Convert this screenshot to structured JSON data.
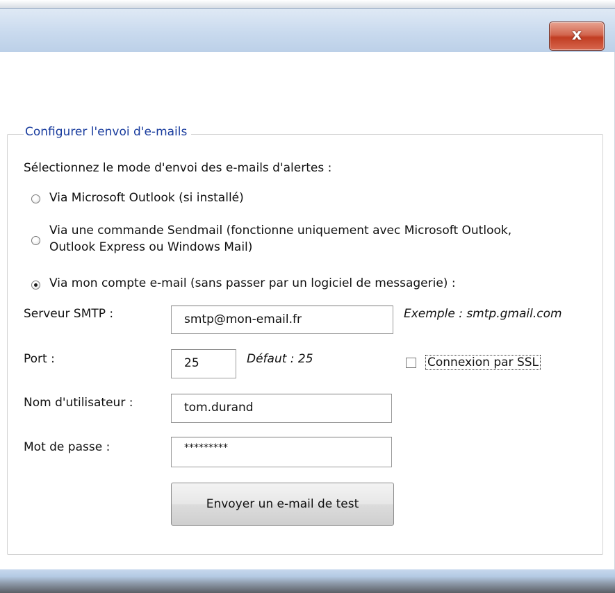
{
  "window": {
    "close_label": "x"
  },
  "group": {
    "title": "Configurer l'envoi d'e-mails",
    "instruction": "Sélectionnez le mode d'envoi des e-mails d'alertes :"
  },
  "modes": {
    "outlook": "Via Microsoft Outlook (si installé)",
    "sendmail_line1": "Via une commande Sendmail (fonctionne uniquement avec Microsoft Outlook,",
    "sendmail_line2": "Outlook Express ou Windows Mail)",
    "account": "Via mon compte e-mail (sans passer par un logiciel de messagerie) :",
    "selected": "account"
  },
  "form": {
    "smtp_label": "Serveur SMTP :",
    "smtp_value": "smtp@mon-email.fr",
    "smtp_hint": "Exemple : smtp.gmail.com",
    "port_label": "Port :",
    "port_value": "25",
    "port_hint": "Défaut : 25",
    "ssl_label": "Connexion par SSL",
    "ssl_checked": false,
    "user_label": "Nom d'utilisateur :",
    "user_value": "tom.durand",
    "password_label": "Mot de passe :",
    "password_value": "*********",
    "test_button": "Envoyer un e-mail de test"
  },
  "colors": {
    "legend": "#1a3d9e",
    "close_button": "#c13d22",
    "titlebar": "#c9daee"
  }
}
